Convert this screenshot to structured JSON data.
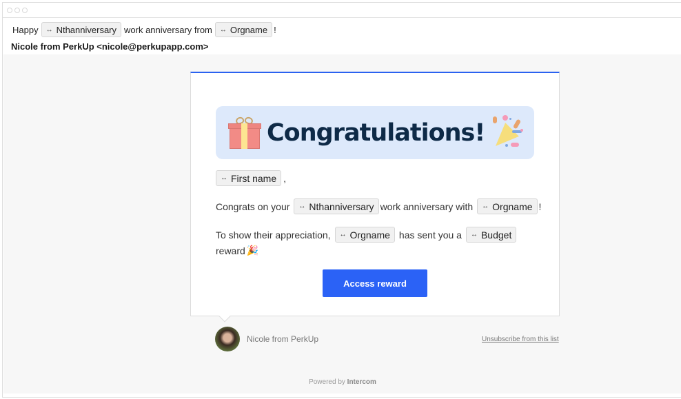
{
  "window": {
    "controls": [
      "close",
      "minimize",
      "maximize"
    ]
  },
  "subject": {
    "prefix": "Happy",
    "chip1": "Nthanniversary",
    "middle": "work anniversary from",
    "chip2": "Orgname",
    "suffix": "!"
  },
  "from": "Nicole from PerkUp <nicole@perkupapp.com>",
  "email": {
    "banner_title": "Congratulations!",
    "greeting_chip": "First name",
    "greeting_suffix": ",",
    "p1": {
      "t1": "Congrats on your",
      "chip1": "Nthanniversary",
      "t2": "work anniversary with",
      "chip2": "Orgname",
      "t3": "!"
    },
    "p2": {
      "t1": "To show their appreciation,",
      "chip1": "Orgname",
      "t2": "has sent you a",
      "chip2": "Budget",
      "t3": "reward",
      "emoji": "🎉"
    },
    "cta_label": "Access reward",
    "arrow_glyph": "↔"
  },
  "footer": {
    "sender_name": "Nicole from PerkUp",
    "unsubscribe": "Unsubscribe from this list",
    "powered_prefix": "Powered by",
    "powered_brand": "Intercom"
  },
  "colors": {
    "accent": "#2b62f6",
    "banner_bg": "#dde9fb",
    "title": "#0e2a47"
  }
}
